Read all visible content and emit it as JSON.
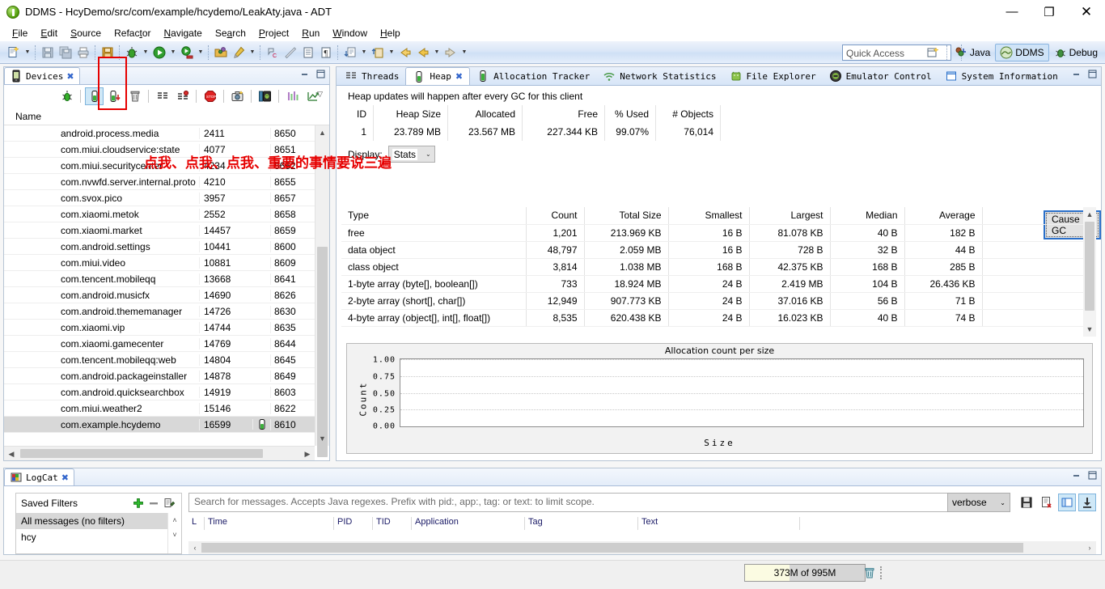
{
  "window": {
    "title": "DDMS - HcyDemo/src/com/example/hcydemo/LeakAty.java - ADT",
    "app_icon": "ddms-icon",
    "minimize": "—",
    "maximize": "❐",
    "close": "✕"
  },
  "menubar": [
    {
      "label": "File"
    },
    {
      "label": "Edit"
    },
    {
      "label": "Source"
    },
    {
      "label": "Refactor"
    },
    {
      "label": "Navigate"
    },
    {
      "label": "Search"
    },
    {
      "label": "Project"
    },
    {
      "label": "Run"
    },
    {
      "label": "Window"
    },
    {
      "label": "Help"
    }
  ],
  "toolbar": {
    "quick_access_placeholder": "Quick Access",
    "buttons": [
      {
        "name": "new-wizard-icon"
      },
      {
        "name": "save-icon"
      },
      {
        "name": "save-all-icon"
      },
      {
        "name": "print-icon"
      },
      {
        "name": "export-icon"
      },
      {
        "name": "debug-icon"
      },
      {
        "name": "run-icon"
      },
      {
        "name": "run-external-tools-icon"
      },
      {
        "name": "open-type-icon"
      },
      {
        "name": "pencil-icon"
      },
      {
        "name": "toggle-comment-icon"
      },
      {
        "name": "ruler-icon"
      },
      {
        "name": "outline-icon"
      },
      {
        "name": "paragraph-icon"
      },
      {
        "name": "next-annotation-icon"
      },
      {
        "name": "previous-annotation-icon"
      },
      {
        "name": "back-icon"
      },
      {
        "name": "last-edit-icon"
      },
      {
        "name": "forward-icon"
      }
    ],
    "perspectives": [
      {
        "label": "Java",
        "icon": "java-perspective-icon",
        "active": false
      },
      {
        "label": "DDMS",
        "icon": "ddms-perspective-icon",
        "active": true
      },
      {
        "label": "Debug",
        "icon": "debug-perspective-icon",
        "active": false
      }
    ],
    "open_perspective_icon": "open-perspective-icon"
  },
  "devices_view": {
    "tab_label": "Devices",
    "tab_icon": "device-icon",
    "tab_close": "✖",
    "minimize_icon": "minimize-view-icon",
    "maximize_icon": "maximize-view-icon",
    "toolbar": [
      {
        "name": "debug-process-icon",
        "selected": false
      },
      {
        "name": "update-heap-icon",
        "selected": true
      },
      {
        "name": "dump-hprof-icon",
        "selected": false
      },
      {
        "name": "cause-gc-icon",
        "selected": false
      },
      {
        "name": "update-threads-icon",
        "selected": false
      },
      {
        "name": "start-method-profiling-icon",
        "selected": false
      },
      {
        "name": "stop-process-icon",
        "selected": false
      },
      {
        "name": "screen-capture-icon",
        "selected": false
      },
      {
        "name": "dump-view-hierarchy-icon",
        "selected": false
      },
      {
        "name": "capture-opengl-trace-icon",
        "selected": false
      },
      {
        "name": "systrace-icon",
        "selected": false
      }
    ],
    "menu_arrow": "▽",
    "column_header": "Name",
    "rows": [
      {
        "name": "android.process.media",
        "pid": "2411",
        "port": "8650",
        "debug": false
      },
      {
        "name": "com.miui.cloudservice:state",
        "pid": "4077",
        "port": "8651",
        "debug": false
      },
      {
        "name": "com.miui.securitycenter",
        "pid": "4234",
        "port": "8652",
        "debug": false
      },
      {
        "name": "com.nvwfd.server.internal.proto",
        "pid": "4210",
        "port": "8655",
        "debug": false
      },
      {
        "name": "com.svox.pico",
        "pid": "3957",
        "port": "8657",
        "debug": false
      },
      {
        "name": "com.xiaomi.metok",
        "pid": "2552",
        "port": "8658",
        "debug": false
      },
      {
        "name": "com.xiaomi.market",
        "pid": "14457",
        "port": "8659",
        "debug": false
      },
      {
        "name": "com.android.settings",
        "pid": "10441",
        "port": "8600",
        "debug": false
      },
      {
        "name": "com.miui.video",
        "pid": "10881",
        "port": "8609",
        "debug": false
      },
      {
        "name": "com.tencent.mobileqq",
        "pid": "13668",
        "port": "8641",
        "debug": false
      },
      {
        "name": "com.android.musicfx",
        "pid": "14690",
        "port": "8626",
        "debug": false
      },
      {
        "name": "com.android.thememanager",
        "pid": "14726",
        "port": "8630",
        "debug": false
      },
      {
        "name": "com.xiaomi.vip",
        "pid": "14744",
        "port": "8635",
        "debug": false
      },
      {
        "name": "com.xiaomi.gamecenter",
        "pid": "14769",
        "port": "8644",
        "debug": false
      },
      {
        "name": "com.tencent.mobileqq:web",
        "pid": "14804",
        "port": "8645",
        "debug": false
      },
      {
        "name": "com.android.packageinstaller",
        "pid": "14878",
        "port": "8649",
        "debug": false
      },
      {
        "name": "com.android.quicksearchbox",
        "pid": "14919",
        "port": "8603",
        "debug": false
      },
      {
        "name": "com.miui.weather2",
        "pid": "15146",
        "port": "8622",
        "debug": false
      },
      {
        "name": "com.example.hcydemo",
        "pid": "16599",
        "port": "8610",
        "debug": true
      }
    ],
    "selected_row": "com.example.hcydemo"
  },
  "annotation": {
    "text": "点我、点我、点我、重要的事情要说三遍",
    "color": "#e60000",
    "box_color": "#e60000"
  },
  "heap_view": {
    "tabs": [
      {
        "label": "Threads",
        "icon": "threads-icon",
        "active": false,
        "closable": false
      },
      {
        "label": "Heap",
        "icon": "heap-icon",
        "active": true,
        "closable": true,
        "close": "✖"
      },
      {
        "label": "Allocation Tracker",
        "icon": "allocation-tracker-icon",
        "active": false,
        "closable": false
      },
      {
        "label": "Network Statistics",
        "icon": "network-statistics-icon",
        "active": false,
        "closable": false
      },
      {
        "label": "File Explorer",
        "icon": "file-explorer-icon",
        "active": false,
        "closable": false
      },
      {
        "label": "Emulator Control",
        "icon": "emulator-control-icon",
        "active": false,
        "closable": false
      },
      {
        "label": "System Information",
        "icon": "system-information-icon",
        "active": false,
        "closable": false
      }
    ],
    "minimize_icon": "minimize-view-icon",
    "maximize_icon": "maximize-view-icon",
    "note": "Heap updates will happen after every GC for this client",
    "summary_headers": [
      "ID",
      "Heap Size",
      "Allocated",
      "Free",
      "% Used",
      "# Objects"
    ],
    "summary_values": [
      "1",
      "23.789 MB",
      "23.567 MB",
      "227.344 KB",
      "99.07%",
      "76,014"
    ],
    "cause_gc_label": "Cause GC",
    "display_label": "Display:",
    "display_value": "Stats",
    "display_arrow": "⌄",
    "stats_headers": [
      "Type",
      "Count",
      "Total Size",
      "Smallest",
      "Largest",
      "Median",
      "Average"
    ],
    "stats_rows": [
      [
        "free",
        "1,201",
        "213.969 KB",
        "16 B",
        "81.078 KB",
        "40 B",
        "182 B"
      ],
      [
        "data object",
        "48,797",
        "2.059 MB",
        "16 B",
        "728 B",
        "32 B",
        "44 B"
      ],
      [
        "class object",
        "3,814",
        "1.038 MB",
        "168 B",
        "42.375 KB",
        "168 B",
        "285 B"
      ],
      [
        "1-byte array (byte[], boolean[])",
        "733",
        "18.924 MB",
        "24 B",
        "2.419 MB",
        "104 B",
        "26.436 KB"
      ],
      [
        "2-byte array (short[], char[])",
        "12,949",
        "907.773 KB",
        "24 B",
        "37.016 KB",
        "56 B",
        "71 B"
      ],
      [
        "4-byte array (object[], int[], float[])",
        "8,535",
        "620.438 KB",
        "24 B",
        "16.023 KB",
        "40 B",
        "74 B"
      ]
    ]
  },
  "chart_data": {
    "type": "bar",
    "title": "Allocation count per size",
    "xlabel": "Size",
    "ylabel": "Count",
    "categories": [],
    "values": [],
    "yticks": [
      "1.00",
      "0.75",
      "0.50",
      "0.25",
      "0.00"
    ],
    "ylim": [
      0,
      1
    ],
    "grid": true,
    "legend": false
  },
  "logcat": {
    "tab_label": "LogCat",
    "tab_icon": "logcat-icon",
    "tab_close": "✖",
    "minimize_icon": "minimize-view-icon",
    "maximize_icon": "maximize-view-icon",
    "saved_filters_label": "Saved Filters",
    "add_icon": "add-filter-icon",
    "remove_icon": "remove-filter-icon",
    "edit_icon": "edit-filter-icon",
    "filters": [
      {
        "label": "All messages (no filters)",
        "selected": true
      },
      {
        "label": "hcy",
        "selected": false
      }
    ],
    "scroll_up": "˄",
    "scroll_down": "˅",
    "search_placeholder": "Search for messages. Accepts Java regexes. Prefix with pid:, app:, tag: or text: to limit scope.",
    "level_value": "verbose",
    "level_arrow": "⌄",
    "icons": [
      {
        "name": "save-log-icon",
        "active": false
      },
      {
        "name": "clear-log-icon",
        "active": false
      },
      {
        "name": "display-view-icon",
        "active": true
      },
      {
        "name": "scroll-lock-icon",
        "active": true
      }
    ],
    "columns": [
      "L",
      "Time",
      "PID",
      "TID",
      "Application",
      "Tag",
      "Text"
    ],
    "hscroll_left": "‹",
    "hscroll_right": "›"
  },
  "statusbar": {
    "heap_text": "373M of 995M",
    "heap_percent": 37,
    "trash_icon": "clear-heap-icon"
  }
}
